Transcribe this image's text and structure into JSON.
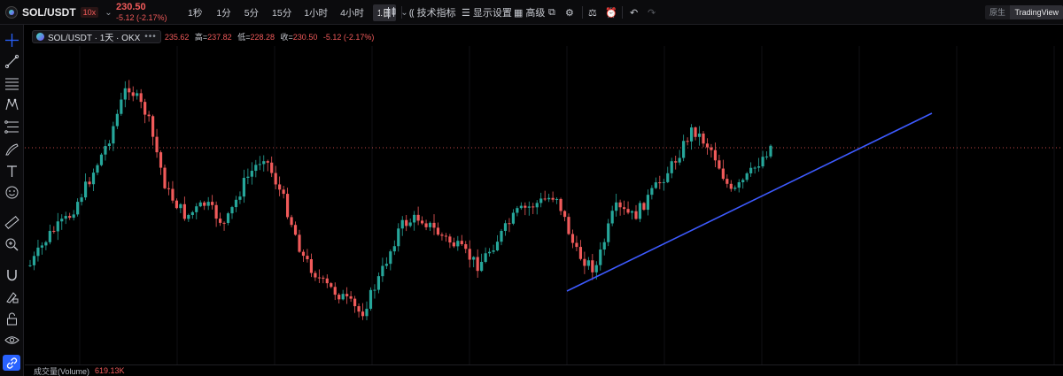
{
  "header": {
    "symbol": "SOL/USDT",
    "leverage": "10x",
    "last_price": "230.50",
    "change": "-5.12 (-2.17%)",
    "intervals": [
      "1秒",
      "1分",
      "5分",
      "15分",
      "1小时",
      "4小时"
    ],
    "selected_interval": "1日",
    "indicators_label": "技术指标",
    "display_label": "显示设置",
    "advanced_label": "高级",
    "view_modes": [
      "原生版",
      "TradingView"
    ],
    "active_view": "TradingView"
  },
  "legend": {
    "symbol_title": "SOL/USDT · 1天 · OKX",
    "open_partial": "235.62",
    "high_label": "高",
    "high": "237.82",
    "low_label": "低",
    "low": "228.28",
    "close_label": "收",
    "close": "230.50",
    "change": "-5.12 (-2.17%)"
  },
  "volume": {
    "label": "成交量(Volume)",
    "value": "619.13K"
  },
  "colors": {
    "up": "#26a69a",
    "down": "#f05a5a",
    "trendline": "#3d5afe",
    "accent": "#2962ff"
  },
  "tools": [
    "crosshair-icon",
    "trend-line-icon",
    "fib-icon",
    "pattern-icon",
    "projection-icon",
    "brush-icon",
    "text-icon",
    "emoji-icon",
    "ruler-icon",
    "zoom-icon",
    "magnet-icon",
    "lock-draw-icon",
    "lock-icon",
    "eye-icon",
    "link-icon"
  ],
  "chart_data": {
    "type": "candlestick",
    "trend": [
      300,
      265,
      245,
      205,
      160,
      95,
      130,
      215,
      245,
      230,
      255,
      205,
      175,
      225,
      290,
      320,
      335,
      355,
      310,
      255,
      245,
      265,
      280,
      300,
      270,
      240,
      230,
      220,
      285,
      305,
      235,
      245,
      215,
      185,
      145,
      170,
      220,
      195,
      165
    ],
    "trendline_from": [
      640,
      329
    ],
    "trendline_to": [
      1052,
      128
    ],
    "last_price_line": 167
  }
}
